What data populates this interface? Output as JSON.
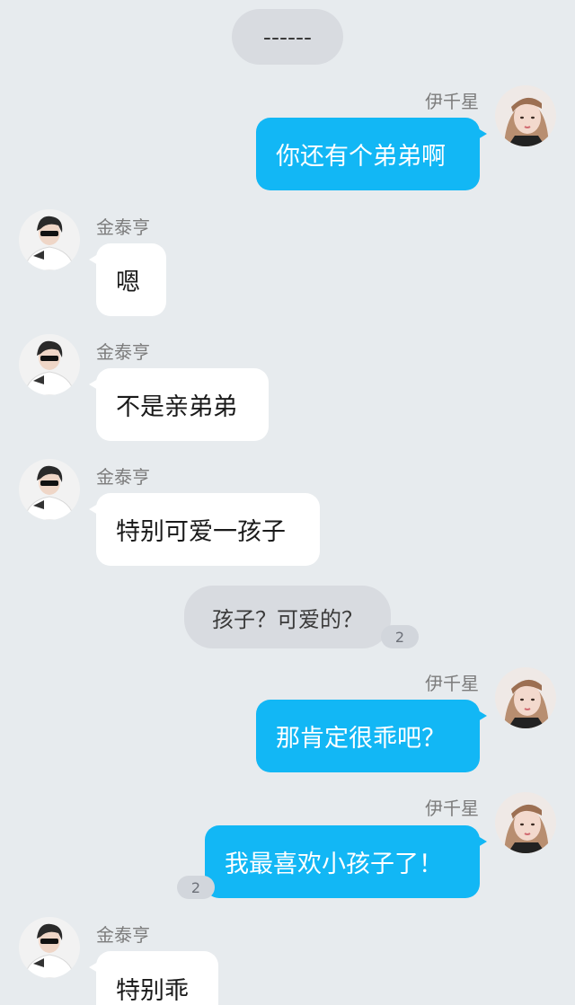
{
  "system_message": {
    "text": "------"
  },
  "messages": [
    {
      "sender": "伊千星",
      "side": "me",
      "text": "你还有个弟弟啊"
    },
    {
      "sender": "金泰亨",
      "side": "other",
      "text": "嗯"
    },
    {
      "sender": "金泰亨",
      "side": "other",
      "text": "不是亲弟弟"
    },
    {
      "sender": "金泰亨",
      "side": "other",
      "text": "特别可爱一孩子"
    },
    {
      "sender": "",
      "side": "center",
      "text": "孩子？可爱的？",
      "count": "2"
    },
    {
      "sender": "伊千星",
      "side": "me",
      "text": "那肯定很乖吧？"
    },
    {
      "sender": "伊千星",
      "side": "me",
      "text": "我最喜欢小孩子了！",
      "count": "2"
    },
    {
      "sender": "金泰亨",
      "side": "other",
      "text": "特别乖"
    }
  ],
  "colors": {
    "background": "#e7ebee",
    "my_bubble": "#12b7f5",
    "other_bubble": "#ffffff",
    "system_bubble": "#d8dbe0"
  },
  "icons": {
    "my_avatar": "girl-portrait-avatar",
    "other_avatar": "boy-portrait-avatar"
  }
}
